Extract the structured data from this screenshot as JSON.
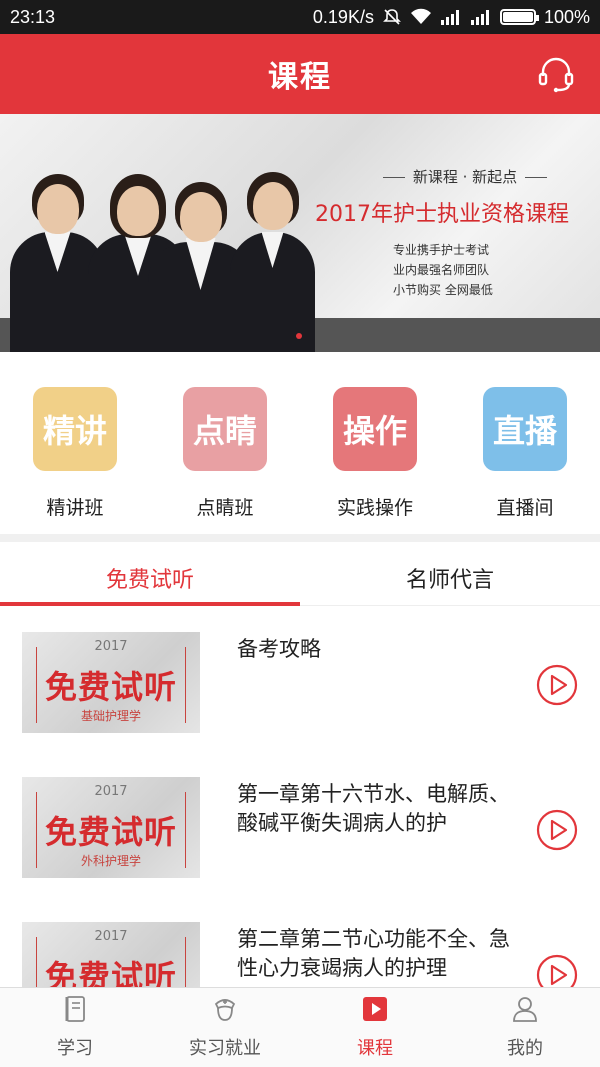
{
  "status": {
    "time": "23:13",
    "speed": "0.19K/s",
    "battery": "100%",
    "battery_level": 1.0
  },
  "header": {
    "title": "课程",
    "support_icon": "headset-icon"
  },
  "banner": {
    "tag": "新课程 · 新起点",
    "headline": "2017年护士执业资格课程",
    "sub": [
      "专业携手护士考试",
      "业内最强名师团队",
      "小节购买 全网最低"
    ]
  },
  "categories": [
    {
      "tile": "精讲",
      "label": "精讲班",
      "color": "#f1d088"
    },
    {
      "tile": "点睛",
      "label": "点睛班",
      "color": "#e8a0a3"
    },
    {
      "tile": "操作",
      "label": "实践操作",
      "color": "#e5777a"
    },
    {
      "tile": "直播",
      "label": "直播间",
      "color": "#7ebfe9"
    }
  ],
  "tabs": [
    {
      "label": "免费试听",
      "active": true
    },
    {
      "label": "名师代言",
      "active": false
    }
  ],
  "list": [
    {
      "thumb_year": "2017",
      "thumb_big": "免费试听",
      "thumb_subject": "基础护理学",
      "title": "备考攻略"
    },
    {
      "thumb_year": "2017",
      "thumb_big": "免费试听",
      "thumb_subject": "外科护理学",
      "title": "第一章第十六节水、电解质、酸碱平衡失调病人的护"
    },
    {
      "thumb_year": "2017",
      "thumb_big": "免费试听",
      "thumb_subject": "",
      "title": "第二章第二节心功能不全、急性心力衰竭病人的护理"
    }
  ],
  "bottom_nav": [
    {
      "label": "学习",
      "icon": "book-icon",
      "active": false
    },
    {
      "label": "实习就业",
      "icon": "nurse-icon",
      "active": false
    },
    {
      "label": "课程",
      "icon": "play-course-icon",
      "active": true
    },
    {
      "label": "我的",
      "icon": "person-icon",
      "active": false
    }
  ],
  "colors": {
    "brand": "#e2363b",
    "accent_text": "#d52b2e"
  }
}
